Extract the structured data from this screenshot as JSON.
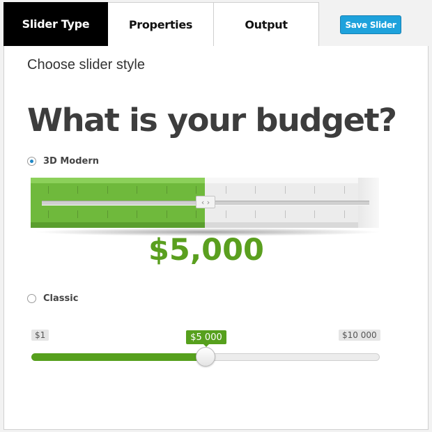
{
  "tabs": [
    {
      "label": "Slider Type",
      "active": true
    },
    {
      "label": "Properties",
      "active": false
    },
    {
      "label": "Output",
      "active": false
    }
  ],
  "toolbar": {
    "save_label": "Save Slider"
  },
  "main": {
    "subtitle": "Choose slider style",
    "headline": "What is your budget?"
  },
  "styles": [
    {
      "label": "3D Modern",
      "selected": true
    },
    {
      "label": "Classic",
      "selected": false
    }
  ],
  "slider3d": {
    "value_label": "$5,000",
    "fill_fraction": 0.5
  },
  "classic": {
    "min_label": "$1",
    "max_label": "$10 000",
    "value_label": "$5 000",
    "fill_fraction": 0.5
  },
  "colors": {
    "accent_green": "#56a01d",
    "save_button": "#1ea2dc",
    "active_tab": "#000000"
  },
  "icons": {
    "handle": "chevrons-left-right-icon",
    "radio_selected": "radio-checked-icon",
    "radio_unselected": "radio-unchecked-icon"
  }
}
